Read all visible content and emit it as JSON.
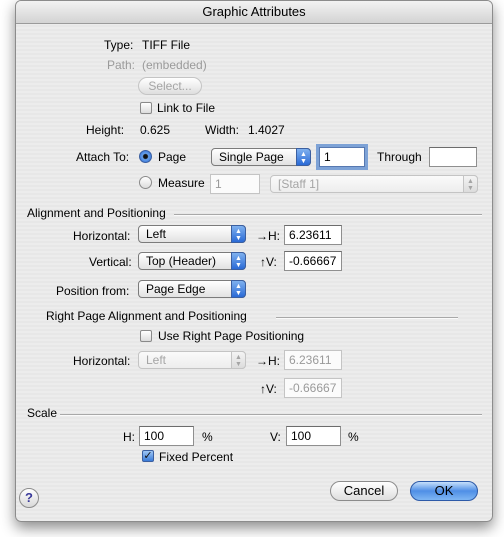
{
  "window": {
    "title": "Graphic Attributes"
  },
  "file": {
    "type_label": "Type:",
    "type_value": "TIFF File",
    "path_label": "Path:",
    "path_value": "(embedded)",
    "select_button": "Select...",
    "link_to_file": {
      "label": "Link to File",
      "checked": false
    },
    "height_label": "Height:",
    "height_value": "0.625",
    "width_label": "Width:",
    "width_value": "1.4027"
  },
  "attach": {
    "label": "Attach To:",
    "page_radio": {
      "label": "Page",
      "checked": true
    },
    "page_mode": "Single Page",
    "page_from": "1",
    "through_label": "Through",
    "page_through": "",
    "measure_radio": {
      "label": "Measure",
      "checked": false
    },
    "measure_value": "1",
    "staff": "[Staff 1]"
  },
  "alignment": {
    "section": "Alignment and Positioning",
    "horizontal_label": "Horizontal:",
    "horizontal_value": "Left",
    "h_offset_label": "→H:",
    "h_offset": "6.23611",
    "vertical_label": "Vertical:",
    "vertical_value": "Top (Header)",
    "v_offset_label": "↑V:",
    "v_offset": "-0.66667",
    "position_from_label": "Position from:",
    "position_from_value": "Page Edge"
  },
  "right_page": {
    "section": "Right Page Alignment and Positioning",
    "use_right": {
      "label": "Use Right Page Positioning",
      "checked": false
    },
    "horizontal_label": "Horizontal:",
    "horizontal_value": "Left",
    "h_offset_label": "→H:",
    "h_offset": "6.23611",
    "v_offset_label": "↑V:",
    "v_offset": "-0.66667"
  },
  "scale": {
    "section": "Scale",
    "h_label": "H:",
    "h_value": "100",
    "h_unit": "%",
    "v_label": "V:",
    "v_value": "100",
    "v_unit": "%",
    "fixed_percent": {
      "label": "Fixed Percent",
      "checked": true
    }
  },
  "buttons": {
    "help": "?",
    "cancel": "Cancel",
    "ok": "OK"
  }
}
